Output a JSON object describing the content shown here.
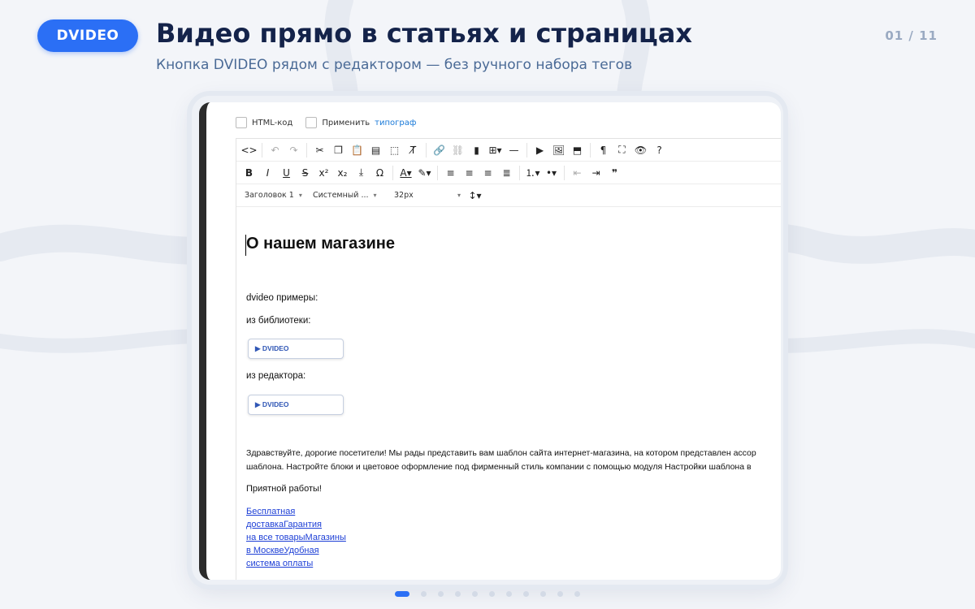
{
  "header": {
    "badge": "DVIDEO",
    "title": "Видео прямо в статьях и страницах",
    "subtitle": "Кнопка DVIDEO рядом с редактором — без ручного набора тегов",
    "counter": "01 / 11"
  },
  "editor": {
    "options": {
      "html_code": "HTML-код",
      "apply": "Применить",
      "typograph": "типограф"
    },
    "format_dropdowns": {
      "block": "Заголовок 1",
      "font": "Системный ...",
      "size": "32px"
    },
    "toolbar_row1_icons": [
      "code-view-icon",
      "undo-icon",
      "redo-icon",
      "cut-icon",
      "copy-icon",
      "paste-icon",
      "paste-text-icon",
      "select-all-icon",
      "clear-format-icon",
      "link-icon",
      "unlink-icon",
      "bookmark-icon",
      "table-icon",
      "horizontal-rule-icon",
      "media-icon",
      "image-icon",
      "template-icon",
      "show-blocks-icon",
      "fullscreen-icon",
      "preview-icon",
      "help-icon"
    ],
    "toolbar_row2_icons": [
      "bold-icon",
      "italic-icon",
      "underline-icon",
      "strikethrough-icon",
      "superscript-icon",
      "subscript-icon",
      "insert-icon",
      "special-char-icon",
      "text-color-icon",
      "background-color-icon",
      "align-left-icon",
      "align-center-icon",
      "align-right-icon",
      "align-justify-icon",
      "numbered-list-icon",
      "bulleted-list-icon",
      "outdent-icon",
      "indent-icon",
      "blockquote-icon"
    ],
    "content": {
      "heading": "О нашем магазине",
      "examples_label": "dvideo примеры:",
      "library_label": "из библиотеки:",
      "library_button": "▶ DVIDEO",
      "editor_label": "из редактора:",
      "editor_button": "▶ DVIDEO",
      "para1_line1": "Здравствуйте, дорогие посетители! Мы рады представить вам шаблон сайта интернет-магазина, на котором представлен ассор",
      "para1_line2": "шаблона. Настройте блоки и цветовое оформление под фирменный стиль компании с помощью модуля Настройки шаблона в",
      "para2": "Приятной работы!",
      "links": [
        "Бесплатная",
        "доставкаГарантия",
        "на все товарыМагазины",
        "в МосквеУдобная",
        "система оплаты"
      ]
    }
  },
  "pagination": {
    "total": 11,
    "current": 1
  },
  "colors": {
    "accent": "#2b6ff5",
    "title": "#14234a",
    "subtitle": "#4a6a96",
    "link": "#1d3fd6"
  }
}
